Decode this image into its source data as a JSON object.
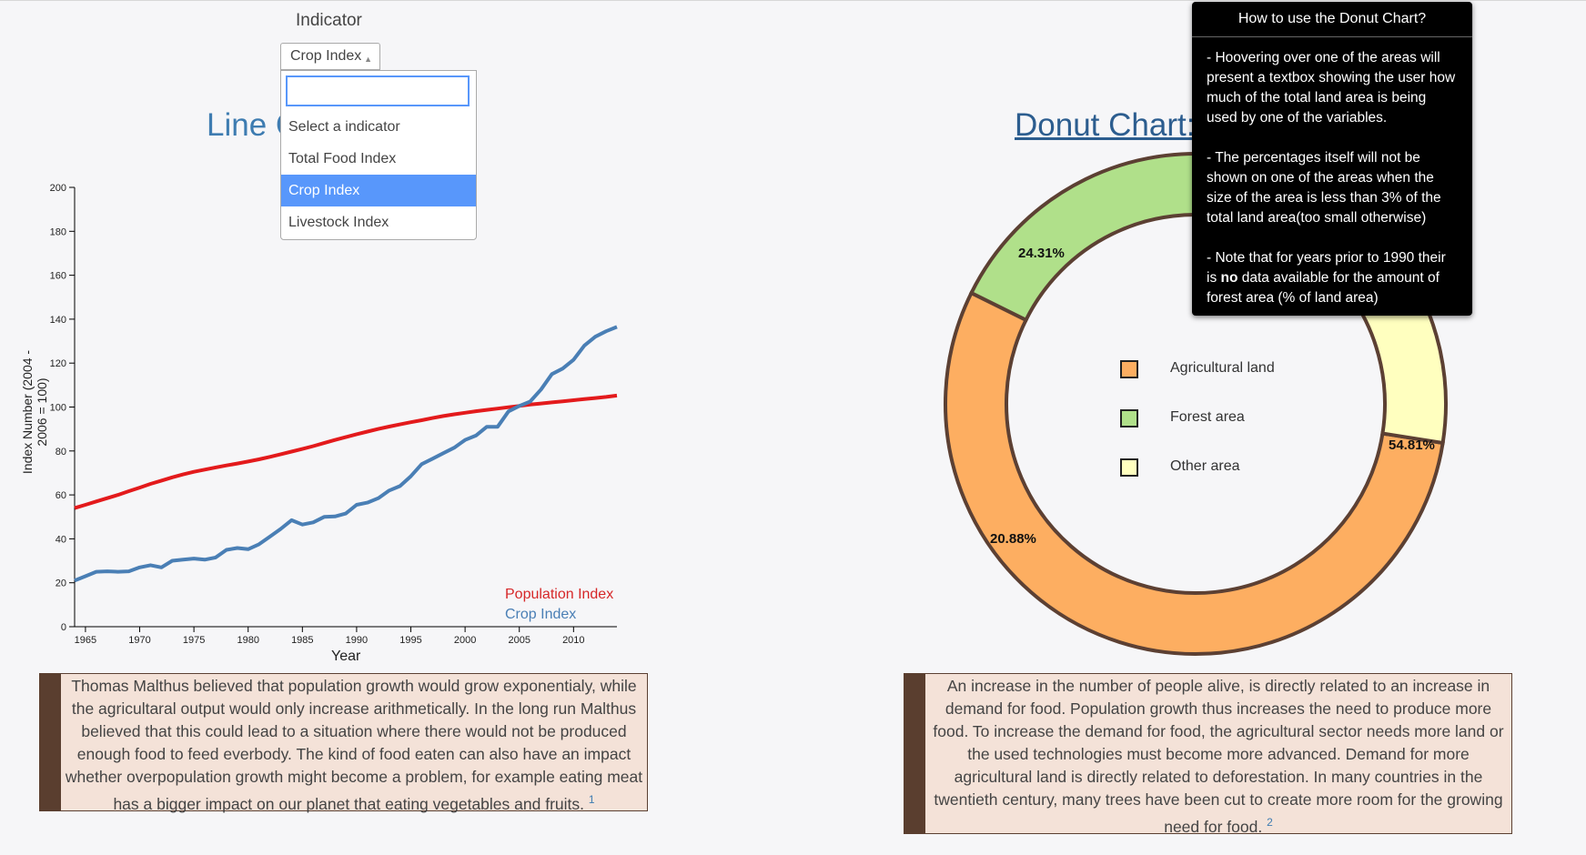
{
  "indicator": {
    "label": "Indicator",
    "selected": "Crop Index",
    "search_value": "",
    "options": [
      "Select a indicator",
      "Total Food Index",
      "Crop Index",
      "Livestock Index"
    ]
  },
  "line_chart": {
    "title": "Line C",
    "xlabel": "Year",
    "ylabel": "Index Number (2004 - 2006 = 100)",
    "legend_population": "Population Index",
    "legend_crop": "Crop Index"
  },
  "donut_chart": {
    "title": "Donut Chart:",
    "pct_agri": "54.81%",
    "pct_forest": "20.88%",
    "pct_other": "24.31%",
    "legend": [
      "Agricultural land",
      "Forest area",
      "Other area"
    ]
  },
  "tooltip": {
    "title": "How to use the Donut Chart?",
    "p1": "- Hoovering over one of the areas will present a textbox showing the user how much of the total land area is being used by one of the variables.",
    "p2": "- The percentages itself will not be shown on one of the areas when the size of the area is less than 3% of the total land area(too small otherwise)",
    "p3_pre": "- Note that for years prior to 1990 their is ",
    "p3_bold": "no",
    "p3_post": " data available for the amount of forest area (% of land area)"
  },
  "text_left": "Thomas Malthus believed that population growth would grow exponentialy, while the agricultaral output would only increase arithmetically. In the long run Malthus believed that this could lead to a situation where there would not be produced enough food to feed everbody. The kind of food eaten can also have an impact whether overpopulation growth might become a problem, for example eating meat has a bigger impact on our planet that eating vegetables and fruits.",
  "text_left_ref": "1",
  "text_right": "An increase in the number of people alive, is directly related to an increase in demand for food. Population growth thus increases the need to produce more food. To increase the demand for food, the agricultural sector needs more land or the used technologies must become more advanced. Demand for more agricultural land is directly related to deforestation. In many countries in the twentieth century, many trees have been cut to create more room for the growing need for food.",
  "text_right_ref": "2",
  "colors": {
    "population": "#e31a1c",
    "crop": "#4a7fb5",
    "agricultural": "#fdae61",
    "forest": "#b0e08a",
    "other": "#ffffbf",
    "donut_stroke": "#5c4033"
  },
  "chart_data": [
    {
      "type": "line",
      "xlabel": "Year",
      "ylabel": "Index Number (2004 - 2006 = 100)",
      "xlim": [
        1964,
        2014
      ],
      "ylim": [
        0,
        200
      ],
      "x_ticks": [
        1965,
        1970,
        1975,
        1980,
        1985,
        1990,
        1995,
        2000,
        2005,
        2010
      ],
      "y_ticks": [
        0,
        20,
        40,
        60,
        80,
        100,
        120,
        140,
        160,
        180,
        200
      ],
      "x": [
        1964,
        1965,
        1966,
        1967,
        1968,
        1969,
        1970,
        1971,
        1972,
        1973,
        1974,
        1975,
        1976,
        1977,
        1978,
        1979,
        1980,
        1981,
        1982,
        1983,
        1984,
        1985,
        1986,
        1987,
        1988,
        1989,
        1990,
        1991,
        1992,
        1993,
        1994,
        1995,
        1996,
        1997,
        1998,
        1999,
        2000,
        2001,
        2002,
        2003,
        2004,
        2005,
        2006,
        2007,
        2008,
        2009,
        2010,
        2011,
        2012,
        2013,
        2014
      ],
      "series": [
        {
          "name": "Population Index",
          "values": [
            54,
            55.5,
            57,
            58.5,
            60,
            61.7,
            63.3,
            65,
            66.5,
            68,
            69.3,
            70.5,
            71.5,
            72.5,
            73.4,
            74.3,
            75.2,
            76.2,
            77.3,
            78.5,
            79.7,
            80.9,
            82.2,
            83.6,
            85,
            86.3,
            87.6,
            88.8,
            90,
            91.1,
            92.1,
            93.1,
            94,
            95,
            95.9,
            96.7,
            97.4,
            98.1,
            98.7,
            99.3,
            99.9,
            100.5,
            101.1,
            101.6,
            102.1,
            102.6,
            103.1,
            103.6,
            104.1,
            104.6,
            105.2
          ]
        },
        {
          "name": "Crop Index",
          "values": [
            21,
            23,
            25,
            25.2,
            25,
            25.2,
            27,
            28,
            27,
            30,
            30.5,
            31,
            30.5,
            31.5,
            35,
            35.8,
            35.3,
            37.5,
            41,
            44.5,
            48.5,
            46.5,
            47.5,
            50,
            50.2,
            51.5,
            55.5,
            56.5,
            58.5,
            62,
            64,
            68.5,
            74,
            76.5,
            79,
            81.5,
            85,
            87,
            91,
            91,
            98,
            100.5,
            102.5,
            108,
            115,
            117.5,
            121.5,
            128,
            132,
            134.5,
            136.5
          ]
        }
      ]
    },
    {
      "type": "pie",
      "categories": [
        "Agricultural land",
        "Forest area",
        "Other area"
      ],
      "values": [
        54.81,
        20.88,
        24.31
      ],
      "donut": true
    }
  ]
}
